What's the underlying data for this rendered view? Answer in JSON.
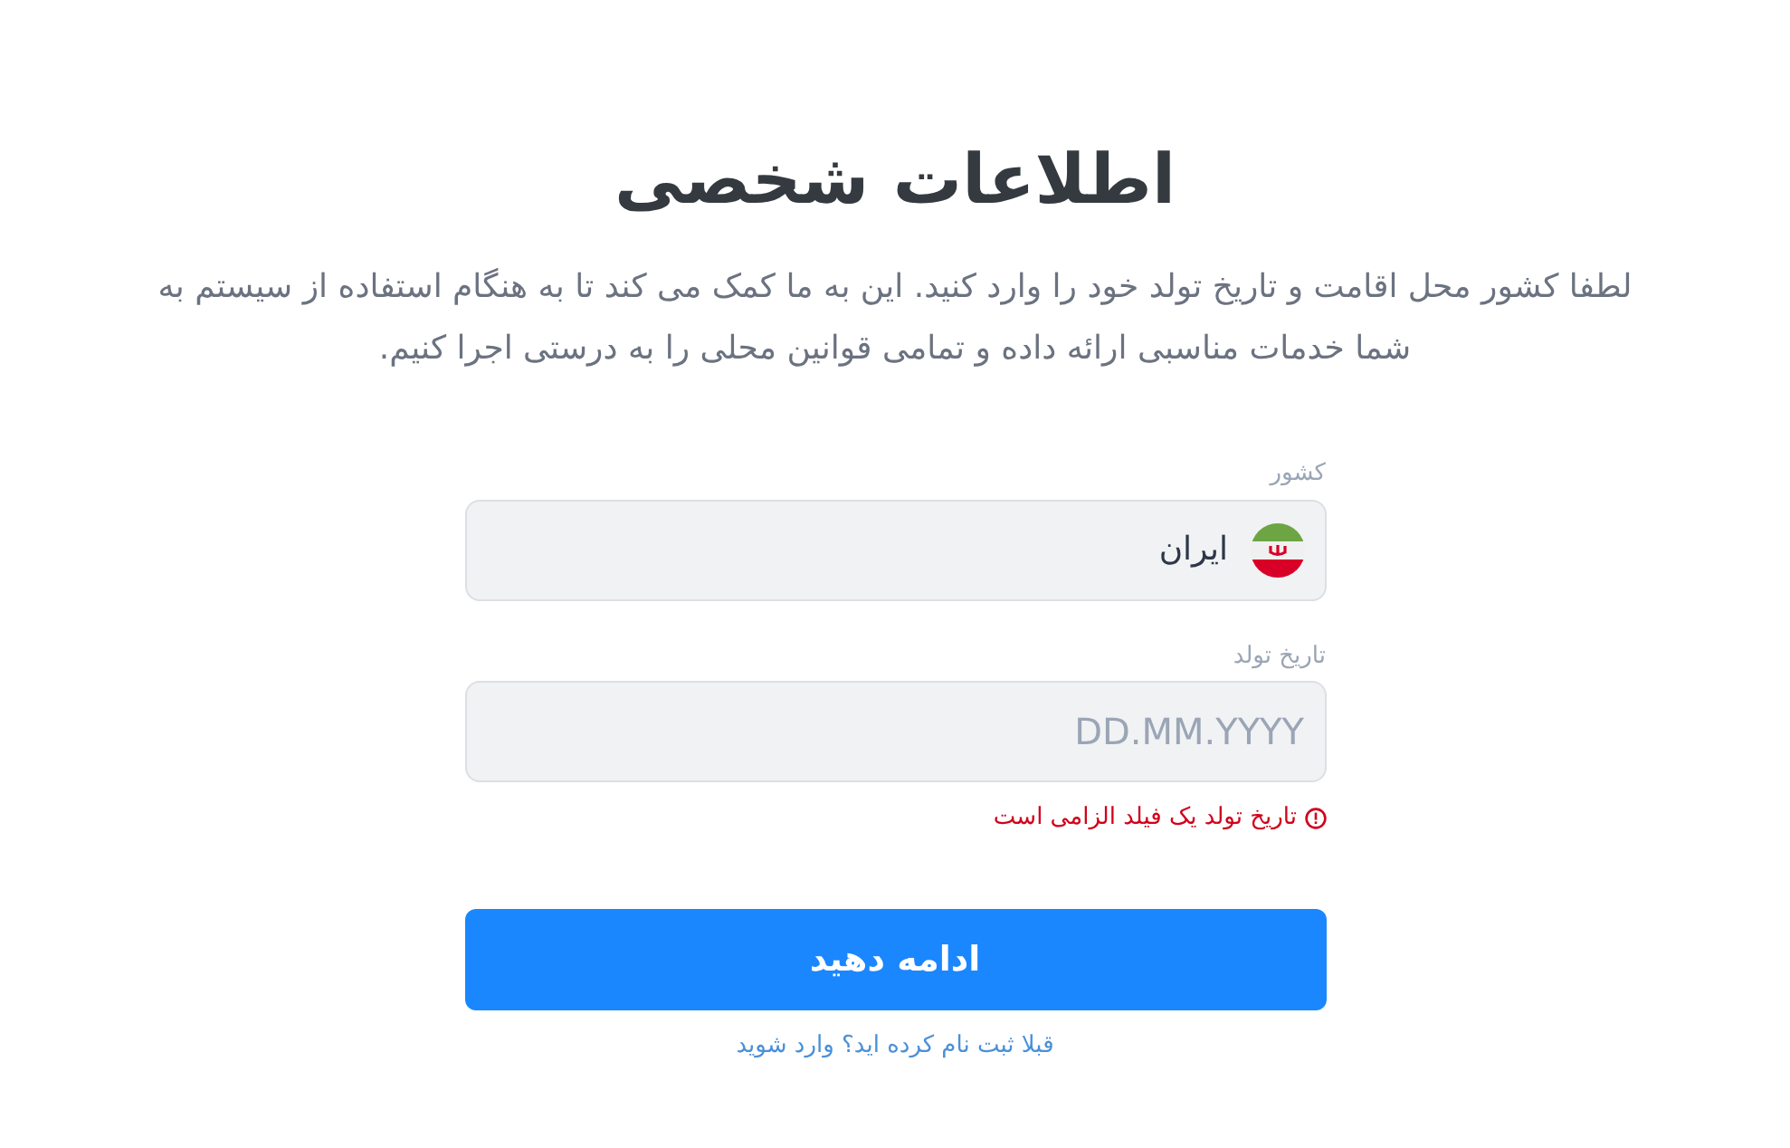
{
  "header": {
    "title": "اطلاعات شخصی",
    "description": "لطفا کشور محل اقامت و تاریخ تولد خود را وارد کنید. این به ما کمک می کند تا به هنگام استفاده از سیستم به شما خدمات مناسبی ارائه داده و تمامی قوانین محلی را به درستی اجرا کنیم."
  },
  "form": {
    "fields": [
      {
        "kind": "select",
        "label": "کشور",
        "value": "ایران"
      },
      {
        "kind": "text",
        "label": "تاریخ تولد",
        "placeholder": "DD.MM.YYYY",
        "error": "تاریخ تولد یک فیلد الزامی است"
      }
    ],
    "submit": "ادامه دهید",
    "login_link": "قبلا ثبت نام کرده اید؟ وارد شوید"
  }
}
